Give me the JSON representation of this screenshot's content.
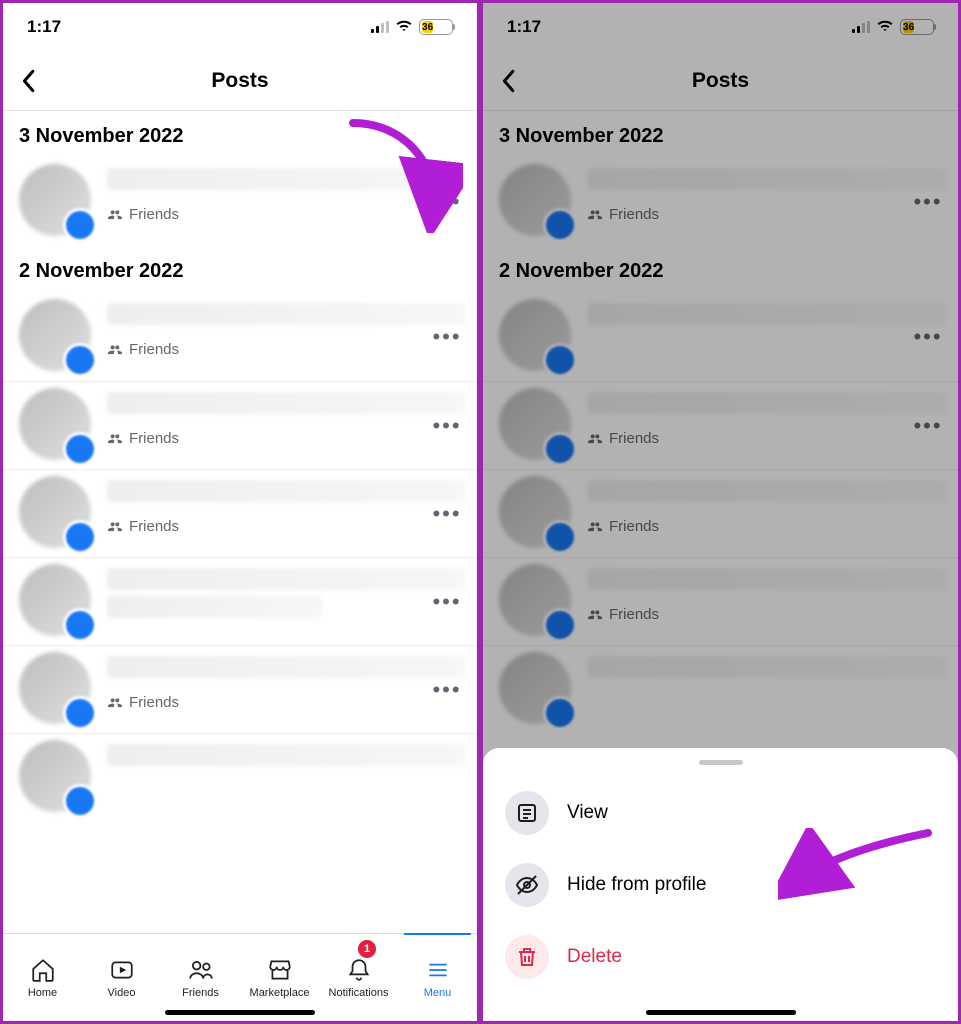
{
  "status": {
    "time": "1:17",
    "battery_pct": "36"
  },
  "header": {
    "title": "Posts"
  },
  "dates": {
    "d1": "3 November 2022",
    "d2": "2 November 2022"
  },
  "audience_label": "Friends",
  "tabbar": {
    "home": "Home",
    "video": "Video",
    "friends": "Friends",
    "marketplace": "Marketplace",
    "notifications": "Notifications",
    "menu": "Menu",
    "notif_count": "1"
  },
  "sheet": {
    "view": "View",
    "hide": "Hide from profile",
    "delete": "Delete"
  }
}
